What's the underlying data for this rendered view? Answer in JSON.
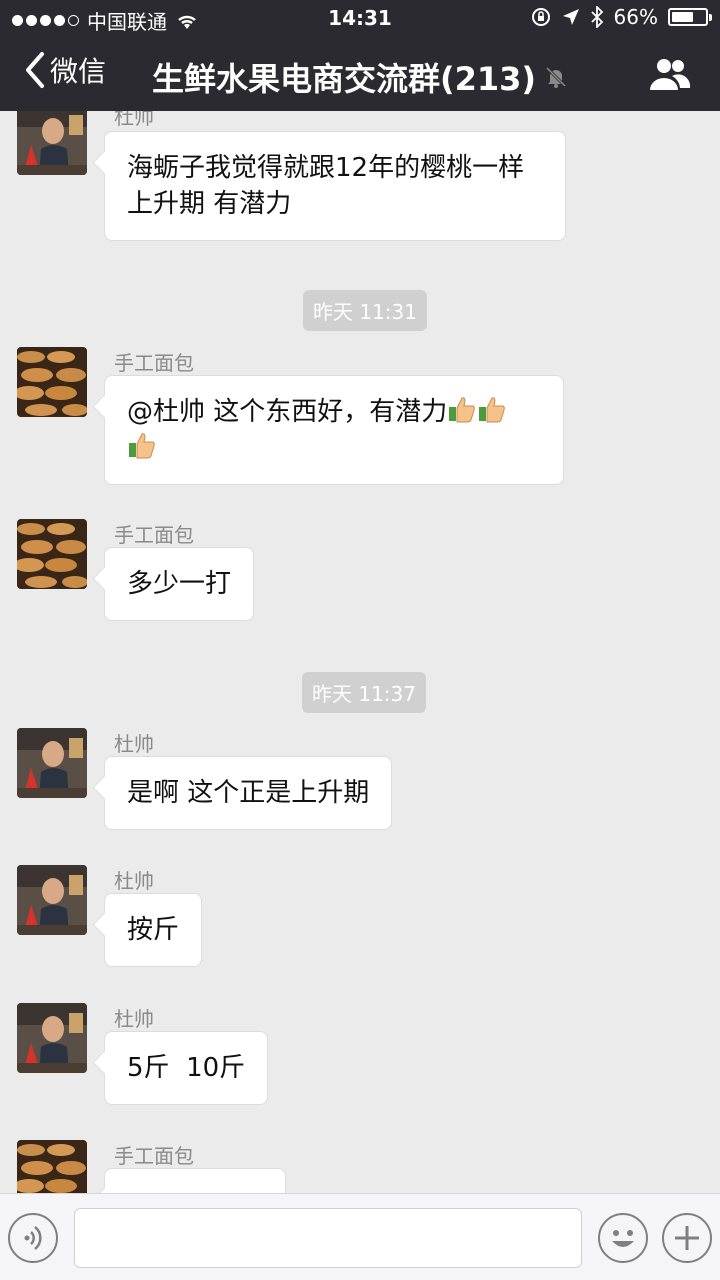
{
  "status_bar": {
    "carrier": "中国联通",
    "time": "14:31",
    "battery_percent": "66%",
    "battery_level": 0.66
  },
  "nav": {
    "back_label": "微信",
    "title": "生鲜水果电商交流群(213)"
  },
  "messages": [
    {
      "sender": "杜帅",
      "text": "海蛎子我觉得就跟12年的樱桃一样  上升期 有潜力"
    },
    {
      "timestamp": "昨天 11:31"
    },
    {
      "sender": "手工面包",
      "text": "@杜帅 这个东西好，有潜力"
    },
    {
      "sender": "手工面包",
      "text": "多少一打"
    },
    {
      "timestamp": "昨天 11:37"
    },
    {
      "sender": "杜帅",
      "text": "是啊 这个正是上升期"
    },
    {
      "sender": "杜帅",
      "text": "按斤"
    },
    {
      "sender": "杜帅",
      "text": "5斤  10斤"
    },
    {
      "sender": "手工面包",
      "text": ""
    }
  ],
  "icons": {
    "status": [
      "signal-dots-icon",
      "wifi-icon",
      "lock-rotation-icon",
      "location-arrow-icon",
      "bluetooth-icon",
      "battery-icon"
    ],
    "nav": [
      "chevron-left-icon",
      "mute-bell-icon",
      "group-people-icon"
    ],
    "input": [
      "voice-icon",
      "emoji-icon",
      "plus-icon"
    ],
    "inline": "thumbs-up-icon"
  },
  "colors": {
    "nav_bg": "#2b2a30",
    "chat_bg": "#ebebeb",
    "bubble_bg": "#ffffff",
    "time_pill": "#d0d0d0"
  }
}
